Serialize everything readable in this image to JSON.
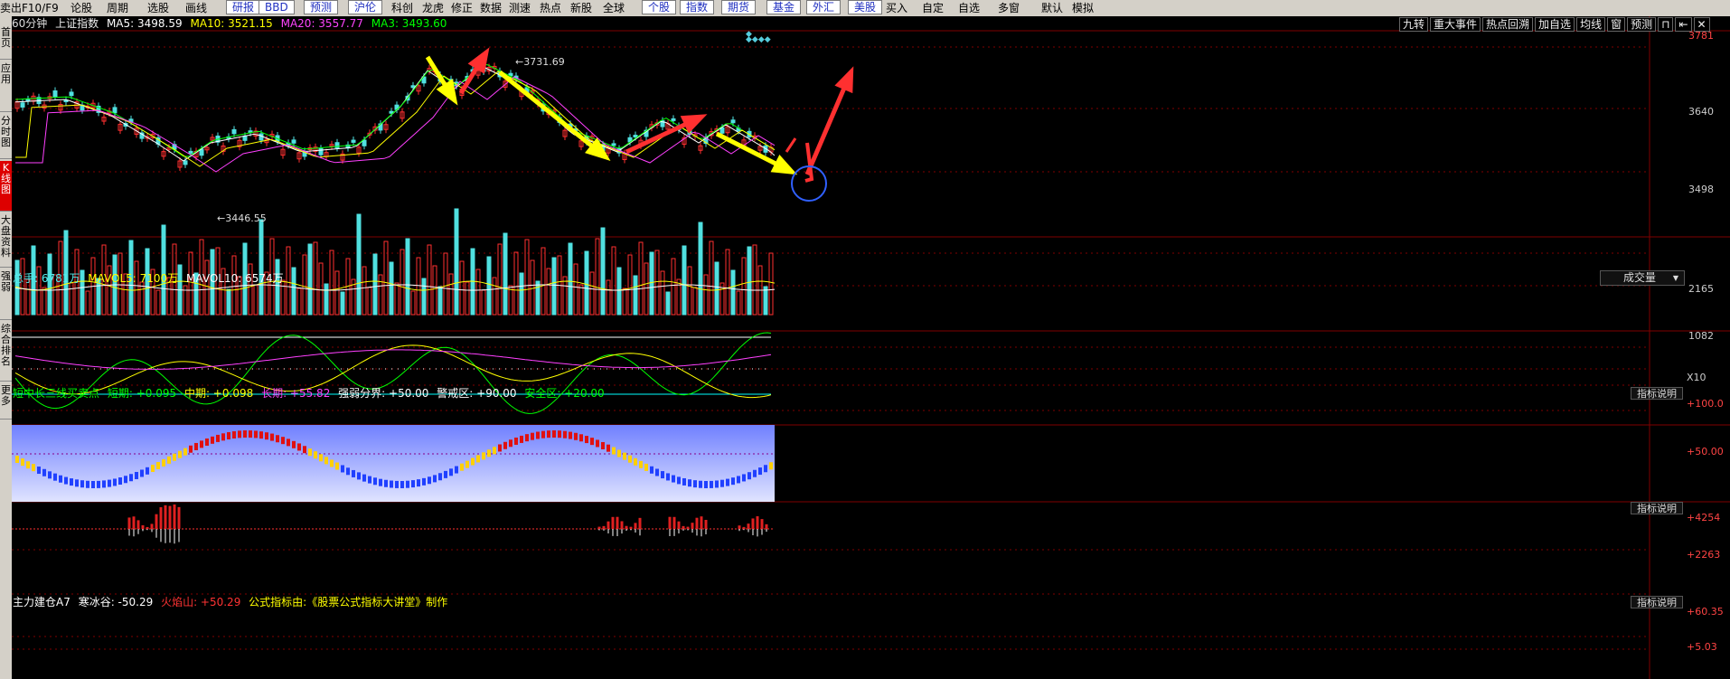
{
  "menu": {
    "items": [
      "卖出",
      "F10/F9",
      "论股",
      "周期",
      "选股",
      "画线",
      "研报",
      "BBD",
      "预测",
      "沪伦",
      "科创",
      "龙虎",
      "修正",
      "数据",
      "测速",
      "热点",
      "新股",
      "全球",
      "个股",
      "指数",
      "期货",
      "基金",
      "外汇",
      "美股",
      "买入",
      "自定",
      "自选",
      "多窗",
      "默认",
      "模拟"
    ]
  },
  "sidebar": {
    "items": [
      "首页",
      "应用",
      "分时图",
      "K线图",
      "大盘资料",
      "强弱",
      "综合排名",
      "更多"
    ]
  },
  "main": {
    "period": "60分钟",
    "name": "上证指数",
    "ma5": "MA5: 3498.59",
    "ma10": "MA10: 3521.15",
    "ma20": "MA20: 3557.77",
    "ma3": "MA3: 3493.60",
    "toolbar": [
      "九转",
      "重大事件",
      "热点回溯",
      "加自选",
      "均线",
      "窗",
      "预测"
    ],
    "high_label": "3731.69",
    "low_label": "3446.55",
    "axis": [
      "3781",
      "3640",
      "3498"
    ]
  },
  "volume": {
    "zs": "总手: 6781万",
    "mavol5": "MAVOL5: 7100万",
    "mavol10": "MAVOL10: 6574万",
    "selector": "成交量",
    "axis": [
      "2165",
      "1082",
      "X10"
    ]
  },
  "ind1": {
    "name": "短中长三线买卖点",
    "short": "短期: +0.095",
    "mid": "中期: +0.098",
    "long": "长期: +55.82",
    "split": "强弱分界: +50.00",
    "warn": "警戒区: +90.00",
    "safe": "安全区: +20.00",
    "explain": "指标说明",
    "axis": [
      "+100.0",
      "+50.00"
    ]
  },
  "ind2": {
    "explain": "指标说明",
    "axis": [
      "+4254",
      "+2263"
    ]
  },
  "ind3": {
    "name": "主力建仓A7",
    "cold": "寒冰谷: -50.29",
    "hot": "火焰山: +50.29",
    "credit": "公式指标由:《股票公式指标大讲堂》制作",
    "explain": "指标说明",
    "axis": [
      "+60.35",
      "+5.03"
    ]
  },
  "colors": {
    "grid": "#800000",
    "up": "#ff3030",
    "down": "#50e0e0",
    "ma5": "#ffffff",
    "ma10": "#ffff00",
    "ma20": "#ff40ff",
    "ma3": "#00ff00",
    "arrow_yellow": "#ffff00",
    "arrow_red": "#ff3030",
    "circle": "#3060ff"
  }
}
